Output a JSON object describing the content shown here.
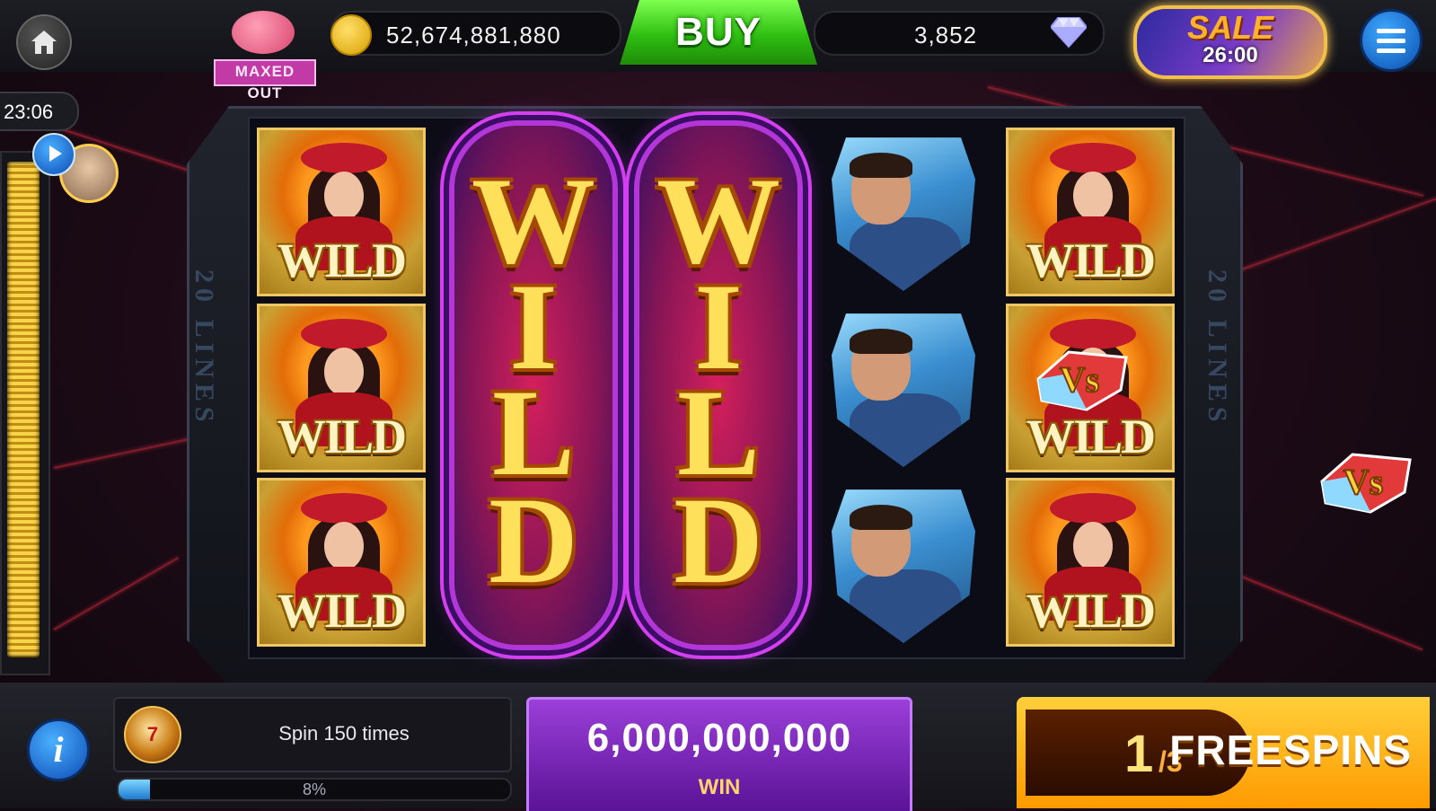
{
  "header": {
    "piggy_bank_label": "MAXED OUT",
    "coins": "52,674,881,880",
    "buy_label": "BUY",
    "gems": "3,852",
    "sale_label": "SALE",
    "sale_timer": "26:00"
  },
  "sidebar": {
    "timer": "23:06"
  },
  "reels": {
    "lines_label": "20 LINES",
    "wild_symbol_label": "WILD",
    "tall_wild_letters": [
      "W",
      "I",
      "L",
      "D"
    ],
    "vs_label": "Vs"
  },
  "footer": {
    "info_label": "i",
    "quest_text": "Spin 150 times",
    "quest_progress_label": "8%",
    "quest_progress_fraction": 0.08,
    "win_amount": "6,000,000,000",
    "win_label": "WIN",
    "freespins_current": "1",
    "freespins_total": "/3",
    "freespins_label": "FREESPINS"
  },
  "colors": {
    "buy_green": "#2fbf12",
    "win_purple": "#7a26b8",
    "freespins_orange": "#ffb000",
    "coin_gold": "#f5c400"
  }
}
